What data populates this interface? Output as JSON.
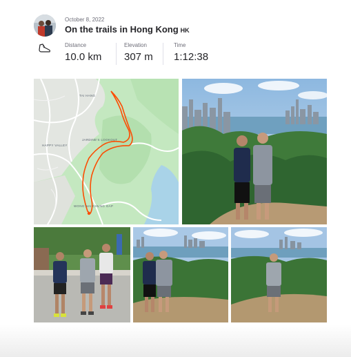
{
  "activity": {
    "date": "October 8, 2022",
    "title": "On the trails in Hong Kong",
    "flag_label": "HK",
    "sport_icon": "running-shoe-icon",
    "colors": {
      "route": "#fc4c02",
      "text": "#242428",
      "muted": "#6d6d78"
    }
  },
  "stats": [
    {
      "label": "Distance",
      "value": "10.0 km"
    },
    {
      "label": "Elevation",
      "value": "307 m"
    },
    {
      "label": "Time",
      "value": "1:12:38"
    }
  ],
  "map": {
    "place_labels": [
      "TAI HANG",
      "HAPPY VALLEY",
      "JARDINE'S LOOKOUT",
      "WONG NAI CHUNG GAP"
    ]
  },
  "photos": [
    {
      "description_icon": "photo-two-men-city-view"
    },
    {
      "description_icon": "photo-three-runners-road"
    },
    {
      "description_icon": "photo-two-men-harbour"
    },
    {
      "description_icon": "photo-runner-trail"
    }
  ]
}
